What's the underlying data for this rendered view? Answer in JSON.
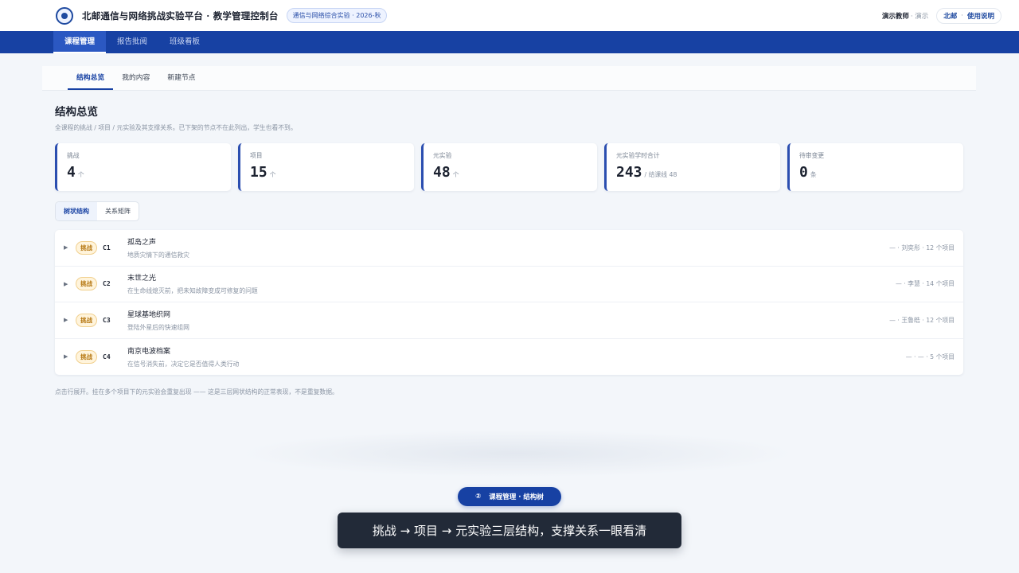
{
  "header": {
    "app_title": "北邮通信与网络挑战实验平台 · 教学管理控制台",
    "term_badge": "通信与网络综合实验 · 2026-秋",
    "teacher_name": "演示教师",
    "teacher_role": "· 演示",
    "campus": "北邮",
    "separator": "·",
    "help": "使用说明"
  },
  "nav": {
    "items": [
      {
        "label": "课程管理",
        "active": true
      },
      {
        "label": "报告批阅",
        "active": false
      },
      {
        "label": "班级看板",
        "active": false
      }
    ]
  },
  "subtabs": [
    {
      "label": "结构总览",
      "active": true
    },
    {
      "label": "我的内容",
      "active": false
    },
    {
      "label": "新建节点",
      "active": false
    }
  ],
  "page": {
    "title": "结构总览",
    "description": "全课程的挑战 / 项目 / 元实验及其支撑关系。已下架的节点不在此列出，学生也看不到。"
  },
  "stats": [
    {
      "label": "挑战",
      "value": "4",
      "unit": "个"
    },
    {
      "label": "项目",
      "value": "15",
      "unit": "个"
    },
    {
      "label": "元实验",
      "value": "48",
      "unit": "个"
    },
    {
      "label": "元实验学时合计",
      "value": "243",
      "unit": "/ 结课线 48"
    },
    {
      "label": "待审变更",
      "value": "0",
      "unit": "条"
    }
  ],
  "view_toggle": {
    "tree": "树状结构",
    "matrix": "关系矩阵"
  },
  "tree_rows": [
    {
      "badge": "挑战",
      "code": "C1",
      "name": "孤岛之声",
      "subtitle": "地质灾情下的通信救灾",
      "meta": "— · 刘奕彤 · 12 个项目"
    },
    {
      "badge": "挑战",
      "code": "C2",
      "name": "末世之光",
      "subtitle": "在生命线熄灭前，把未知故障变成可修复的问题",
      "meta": "— · 李慧 · 14 个项目"
    },
    {
      "badge": "挑战",
      "code": "C3",
      "name": "星球基地织网",
      "subtitle": "登陆外星后的快速组网",
      "meta": "— · 王鲁皓 · 12 个项目"
    },
    {
      "badge": "挑战",
      "code": "C4",
      "name": "南京电波档案",
      "subtitle": "在信号消失前，决定它是否值得人类行动",
      "meta": "— · — · 5 个项目"
    }
  ],
  "footnote": "点击行展开。挂在多个项目下的元实验会重复出现 —— 这是三层网状结构的正常表现，不是重复数据。",
  "overlay": {
    "step_number": "②",
    "step_label": "课程管理 · 结构树",
    "caption": "挑战 → 项目 → 元实验三层结构，支撑关系一眼看清"
  },
  "colors": {
    "brand": "#1741a3",
    "badge_bg": "#fff4dc",
    "badge_text": "#b57610",
    "caption_bg": "#222a38"
  },
  "icons": {
    "logo": "university-seal-icon",
    "expand": "caret-right-icon"
  }
}
